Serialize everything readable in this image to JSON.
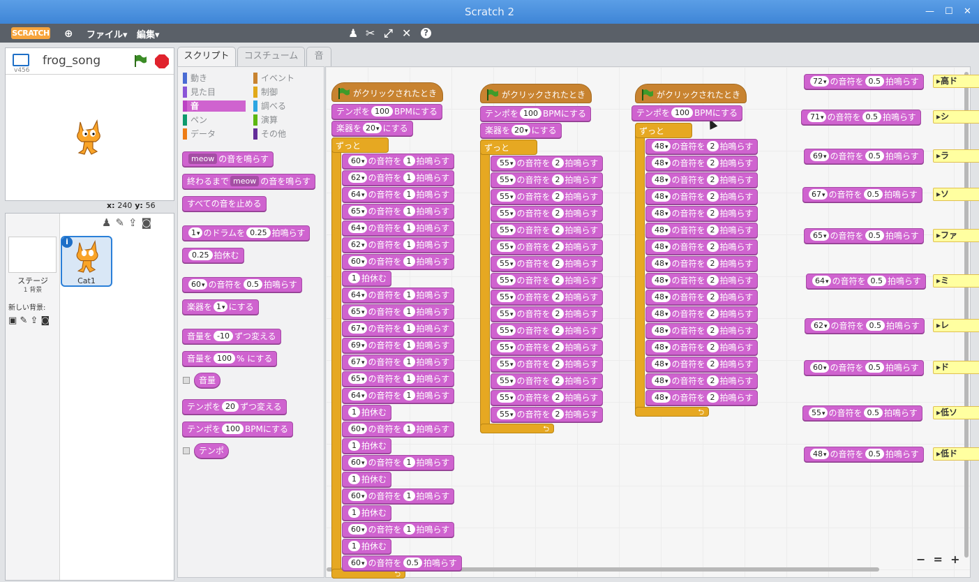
{
  "window": {
    "title": "Scratch 2"
  },
  "menu": {
    "logo": "SCRATCH",
    "file": "ファイル▾",
    "edit": "編集▾"
  },
  "stage": {
    "project_name": "frog_song",
    "version": "v456",
    "coords_x_label": "x:",
    "coords_x": "240",
    "coords_y_label": "y:",
    "coords_y": "56"
  },
  "sprites": {
    "stage_label": "ステージ",
    "backdrop_count": "1 背景",
    "new_backdrop": "新しい背景:",
    "sprite_name": "Cat1"
  },
  "tabs": {
    "scripts": "スクリプト",
    "costumes": "コスチューム",
    "sounds": "音"
  },
  "categories": [
    {
      "label": "動き",
      "color": "#4a6cd4"
    },
    {
      "label": "イベント",
      "color": "#c88330"
    },
    {
      "label": "見た目",
      "color": "#8a55d7"
    },
    {
      "label": "制御",
      "color": "#e1a91a"
    },
    {
      "label": "音",
      "color": "#bb42c3"
    },
    {
      "label": "調べる",
      "color": "#2ca5e2"
    },
    {
      "label": "ペン",
      "color": "#0e9a6c"
    },
    {
      "label": "演算",
      "color": "#5cb712"
    },
    {
      "label": "データ",
      "color": "#ee7d16"
    },
    {
      "label": "その他",
      "color": "#632d99"
    }
  ],
  "palette": {
    "p1a": "meow",
    "p1b": "の音を鳴らす",
    "p2a": "終わるまで",
    "p2b": "meow",
    "p2c": "の音を鳴らす",
    "p3": "すべての音を止める",
    "p4a": "1",
    "p4b": "のドラムを",
    "p4c": "0.25",
    "p4d": "拍鳴らす",
    "p5a": "0.25",
    "p5b": "拍休む",
    "p6a": "60",
    "p6b": "の音符を",
    "p6c": "0.5",
    "p6d": "拍鳴らす",
    "p7a": "楽器を",
    "p7b": "1",
    "p7c": "にする",
    "p8a": "音量を",
    "p8b": "-10",
    "p8c": "ずつ変える",
    "p9a": "音量を",
    "p9b": "100",
    "p9c": "% にする",
    "p10": "音量",
    "p11a": "テンポを",
    "p11b": "20",
    "p11c": "ずつ変える",
    "p12a": "テンポを",
    "p12b": "100",
    "p12c": "BPMにする",
    "p13": "テンポ"
  },
  "scripts": {
    "hat": "がクリックされたとき",
    "tempo_a": "テンポを",
    "tempo_v": "100",
    "tempo_b": "BPMにする",
    "inst_a": "楽器を",
    "inst_b": "にする",
    "inst1": "20",
    "inst2": "20",
    "forever": "ずっと",
    "note_mid": "の音符を",
    "note_end": "拍鳴らす",
    "rest": "拍休む",
    "script1": [
      [
        "60",
        "1"
      ],
      [
        "62",
        "1"
      ],
      [
        "64",
        "1"
      ],
      [
        "65",
        "1"
      ],
      [
        "64",
        "1"
      ],
      [
        "62",
        "1"
      ],
      [
        "60",
        "1"
      ],
      [
        "rest",
        "1"
      ],
      [
        "64",
        "1"
      ],
      [
        "65",
        "1"
      ],
      [
        "67",
        "1"
      ],
      [
        "69",
        "1"
      ],
      [
        "67",
        "1"
      ],
      [
        "65",
        "1"
      ],
      [
        "64",
        "1"
      ],
      [
        "rest",
        "1"
      ],
      [
        "60",
        "1"
      ],
      [
        "rest",
        "1"
      ],
      [
        "60",
        "1"
      ],
      [
        "rest",
        "1"
      ],
      [
        "60",
        "1"
      ],
      [
        "rest",
        "1"
      ],
      [
        "60",
        "1"
      ],
      [
        "rest",
        "1"
      ],
      [
        "60",
        "0.5"
      ]
    ],
    "script2_note": "55",
    "script2_beats": "2",
    "script2_count": 16,
    "script3_note": "48",
    "script3_beats": "2",
    "script3_count": 16,
    "loose": [
      {
        "note": "72",
        "beats": "0.5",
        "comment": "高ド"
      },
      {
        "note": "71",
        "beats": "0.5",
        "comment": "シ"
      },
      {
        "note": "69",
        "beats": "0.5",
        "comment": "ラ"
      },
      {
        "note": "67",
        "beats": "0.5",
        "comment": "ソ"
      },
      {
        "note": "65",
        "beats": "0.5",
        "comment": "ファ"
      },
      {
        "note": "64",
        "beats": "0.5",
        "comment": "ミ"
      },
      {
        "note": "62",
        "beats": "0.5",
        "comment": "レ"
      },
      {
        "note": "60",
        "beats": "0.5",
        "comment": "ド"
      },
      {
        "note": "55",
        "beats": "0.5",
        "comment": "低ソ"
      },
      {
        "note": "48",
        "beats": "0.5",
        "comment": "低ド"
      }
    ]
  },
  "zoom": {
    "out": "−",
    "reset": "=",
    "in": "+"
  }
}
